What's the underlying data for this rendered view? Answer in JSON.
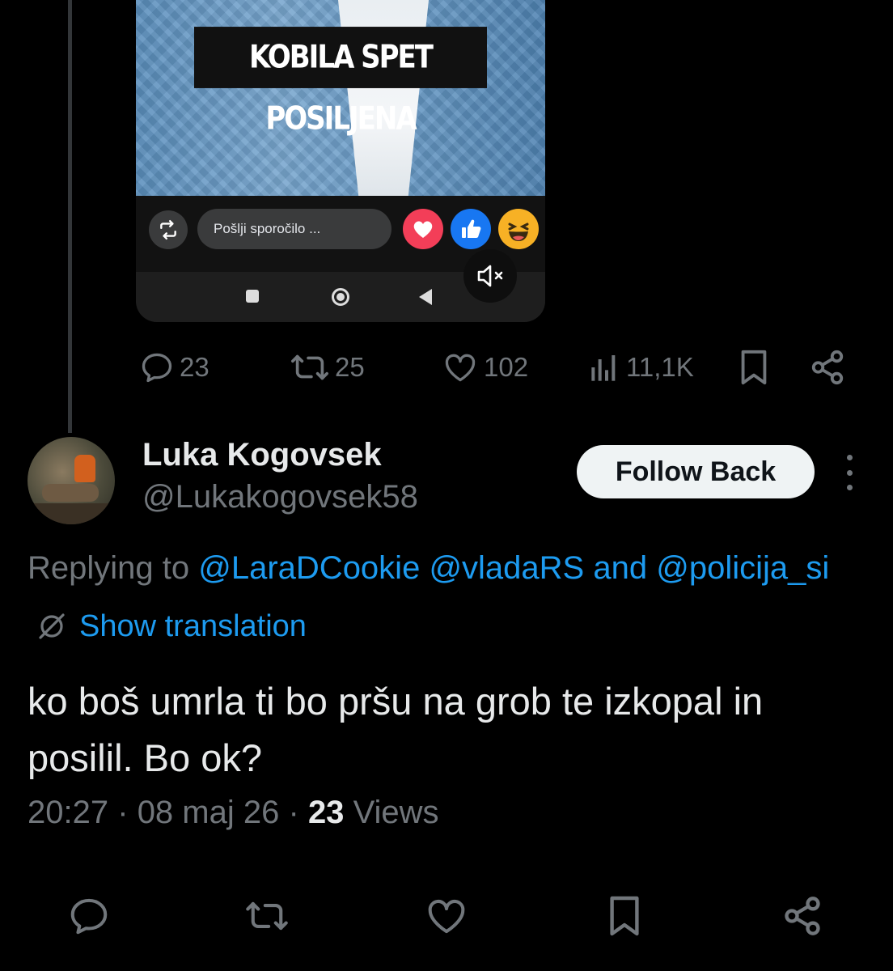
{
  "media": {
    "caption": "KOBILA SPET POSILJENA",
    "message_placeholder": "Pošlji sporočilo ..."
  },
  "quoted_actions": {
    "replies": "23",
    "reposts": "25",
    "likes": "102",
    "views": "11,1K"
  },
  "reply": {
    "display_name": "Luka Kogovsek",
    "handle": "@Lukakogovsek58",
    "follow_label": "Follow Back",
    "replying_prefix": "Replying to",
    "mention_1": "@LaraDCookie",
    "mention_2": "@vladaRS",
    "and_word": "and",
    "mention_3": "@policija_si",
    "show_translation": "Show translation",
    "text": "ko boš umrla ti bo pršu na grob te izkopal in posilil. Bo ok?",
    "time": "20:27",
    "date": "08 maj 26",
    "views_count": "23",
    "views_label": "Views",
    "separator": "·"
  },
  "colors": {
    "background": "#000000",
    "accent": "#1d9bf0",
    "muted": "#71767b",
    "text": "#e7e9ea"
  },
  "icons": [
    "reply-icon",
    "repost-icon",
    "like-icon",
    "views-icon",
    "bookmark-icon",
    "share-icon",
    "translate-icon",
    "mute-icon",
    "more-icon"
  ]
}
